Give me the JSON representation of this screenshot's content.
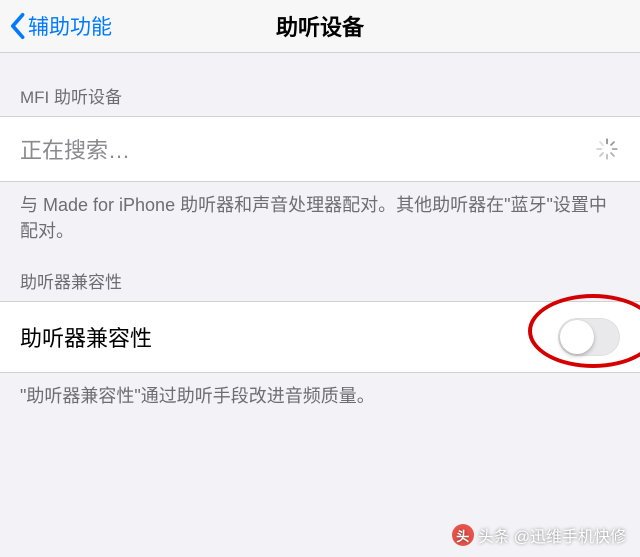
{
  "nav": {
    "back_label": "辅助功能",
    "title": "助听设备"
  },
  "section_mfi": {
    "header": "MFI 助听设备",
    "cell_label": "正在搜索…",
    "footer": "与 Made for iPhone 助听器和声音处理器配对。其他助听器在\"蓝牙\"设置中配对。"
  },
  "section_compat": {
    "header": "助听器兼容性",
    "cell_label": "助听器兼容性",
    "switch_on": false,
    "footer": "\"助听器兼容性\"通过助听手段改进音频质量。"
  },
  "watermark": {
    "prefix": "头条",
    "text": "@迅维手机快修"
  }
}
